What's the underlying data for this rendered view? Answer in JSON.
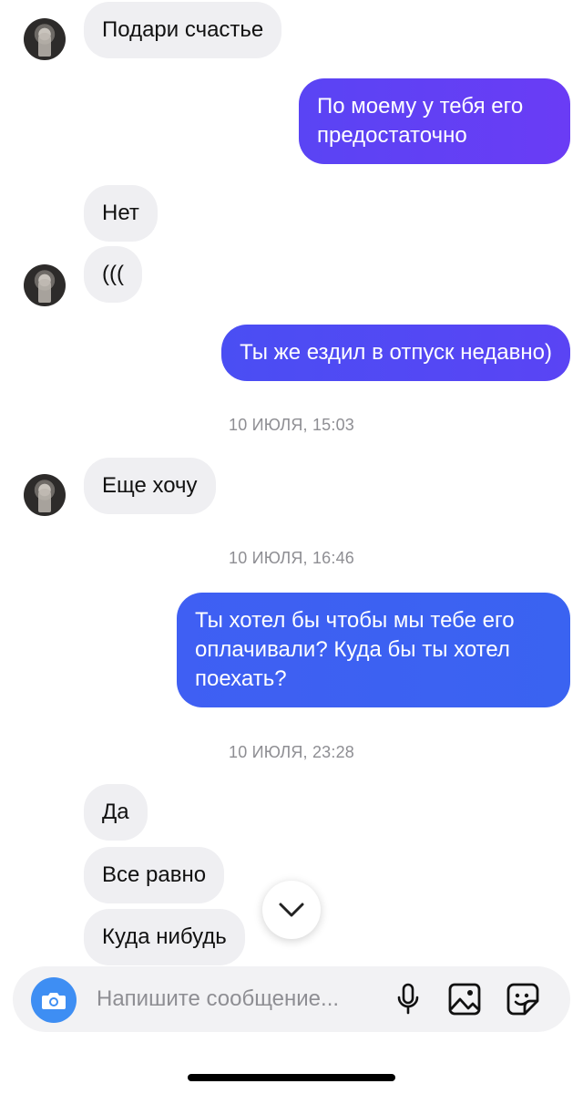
{
  "messages": [
    {
      "text": "Подари счастье"
    },
    {
      "text": "По моему у тебя его\nпредостаточно"
    },
    {
      "text": "Нет"
    },
    {
      "text": "((("
    },
    {
      "text": "Ты же ездил в отпуск недавно)"
    },
    {
      "text": "Еще хочу"
    },
    {
      "text": "Ты хотел бы чтобы мы тебе его\nоплачивали? Куда бы ты хотел\nпоехать?"
    },
    {
      "text": "Да"
    },
    {
      "text": "Все равно"
    },
    {
      "text": "Куда нибудь"
    }
  ],
  "timestamps": [
    "10 ИЮЛЯ, 15:03",
    "10 ИЮЛЯ, 16:46",
    "10 ИЮЛЯ, 23:28"
  ],
  "composer": {
    "placeholder": "Напишите сообщение...",
    "icons": [
      "camera-icon",
      "microphone-icon",
      "gallery-icon",
      "sticker-icon"
    ]
  },
  "colors": {
    "incoming_bubble": "#efeff2",
    "outgoing_gradient": [
      "#3c5cf2",
      "#6a3cf5"
    ],
    "camera_button": "#3e8ef3",
    "timestamp_text": "#8e8e93"
  }
}
